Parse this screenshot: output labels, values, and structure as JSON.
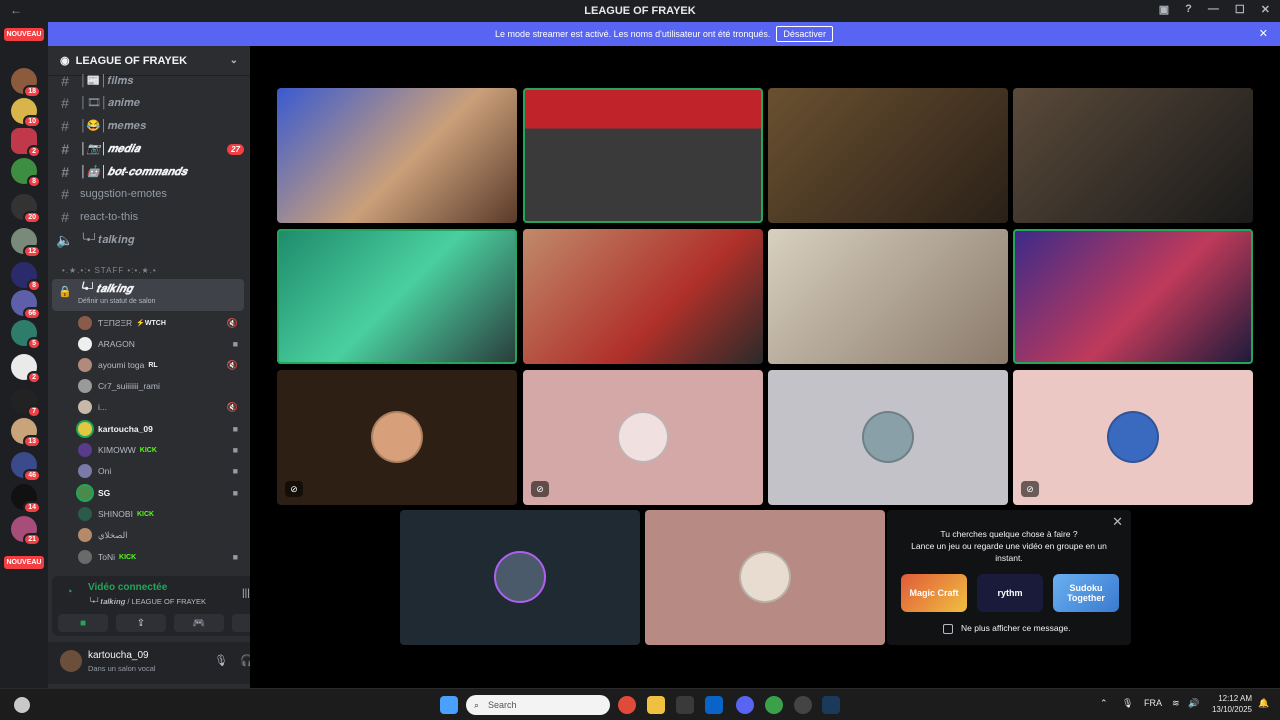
{
  "window": {
    "title": "LEAGUE OF FRAYEK",
    "back_icon": "arrow-left-icon"
  },
  "banner": {
    "text": "Le mode streamer est activé. Les noms d'utilisateur ont été tronqués.",
    "button": "Désactiver"
  },
  "guilds": {
    "new_top": "NOUVEAU",
    "new_bottom": "NOUVEAU",
    "badges": [
      "18",
      "10",
      "2",
      "8",
      "20",
      "12",
      "8",
      "66",
      "5",
      "2",
      "7",
      "13",
      "46",
      "14",
      "21"
    ]
  },
  "server": {
    "name": "LEAGUE OF FRAYEK"
  },
  "channels": [
    {
      "name": "│📰│𝒇𝒊𝒍𝒎𝒔",
      "bold": false
    },
    {
      "name": "│🎞│𝒂𝒏𝒊𝒎𝒆",
      "bold": false
    },
    {
      "name": "│😂│𝒎𝒆𝒎𝒆𝒔",
      "bold": false
    },
    {
      "name": "│📷│𝒎𝒆𝒅𝒊𝒂",
      "bold": true,
      "badge": "27"
    },
    {
      "name": "│🤖│𝒃𝒐𝒕-𝒄𝒐𝒎𝒎𝒂𝒏𝒅𝒔",
      "bold": true
    },
    {
      "name": "suggstion-emotes",
      "bold": false
    },
    {
      "name": "react-to-this",
      "bold": false
    },
    {
      "name": "╰•┘𝒕𝒂𝒍𝒌𝒊𝒏𝒈",
      "bold": false
    }
  ],
  "category": "•.★.•:• STAFF •:•.★.•",
  "voice_channel": {
    "name": "╰•┘𝒕𝒂𝒍𝒌𝒊𝒏𝒈",
    "status": "Définir un statut de salon"
  },
  "members": [
    {
      "name": "ƬΞΠƧΞR",
      "tag": "⚡WTCH"
    },
    {
      "name": "ARAGON",
      "tag": ""
    },
    {
      "name": "ayoumi toga",
      "tag": "RL"
    },
    {
      "name": "Cr7_suiiiiiii_rami",
      "tag": ""
    },
    {
      "name": "i...",
      "tag": ""
    },
    {
      "name": "kartoucha_09",
      "tag": "",
      "highlight": true
    },
    {
      "name": "KIMOWW",
      "tag": "KICK"
    },
    {
      "name": "Oni",
      "tag": ""
    },
    {
      "name": "SG",
      "tag": "",
      "highlight": true
    },
    {
      "name": "SHINOBI",
      "tag": "KICK"
    },
    {
      "name": "الصخلاي",
      "tag": ""
    },
    {
      "name": "ToNi",
      "tag": "KICK"
    }
  ],
  "voice_status": {
    "connected": "Vidéo connectée",
    "location": "╰•┘𝒕𝒂𝒍𝒌𝒊𝒏𝒈 / LEAGUE OF FRAYEK"
  },
  "user": {
    "name": "kartoucha_09",
    "status": "Dans un salon vocal"
  },
  "activity_prompt": {
    "line1": "Tu cherches quelque chose à faire ?",
    "line2": "Lance un jeu ou regarde une vidéo en groupe en un instant.",
    "games": [
      "Magic Craft",
      "rythm",
      "Sudoku Together"
    ],
    "checkbox": "Ne plus afficher ce message."
  },
  "taskbar": {
    "search_placeholder": "Search",
    "lang": "FRA",
    "time": "12:12 AM",
    "date": "13/10/2025"
  },
  "colors": {
    "accent": "#5865f2",
    "speaking": "#23a55a",
    "danger": "#f23f43"
  }
}
